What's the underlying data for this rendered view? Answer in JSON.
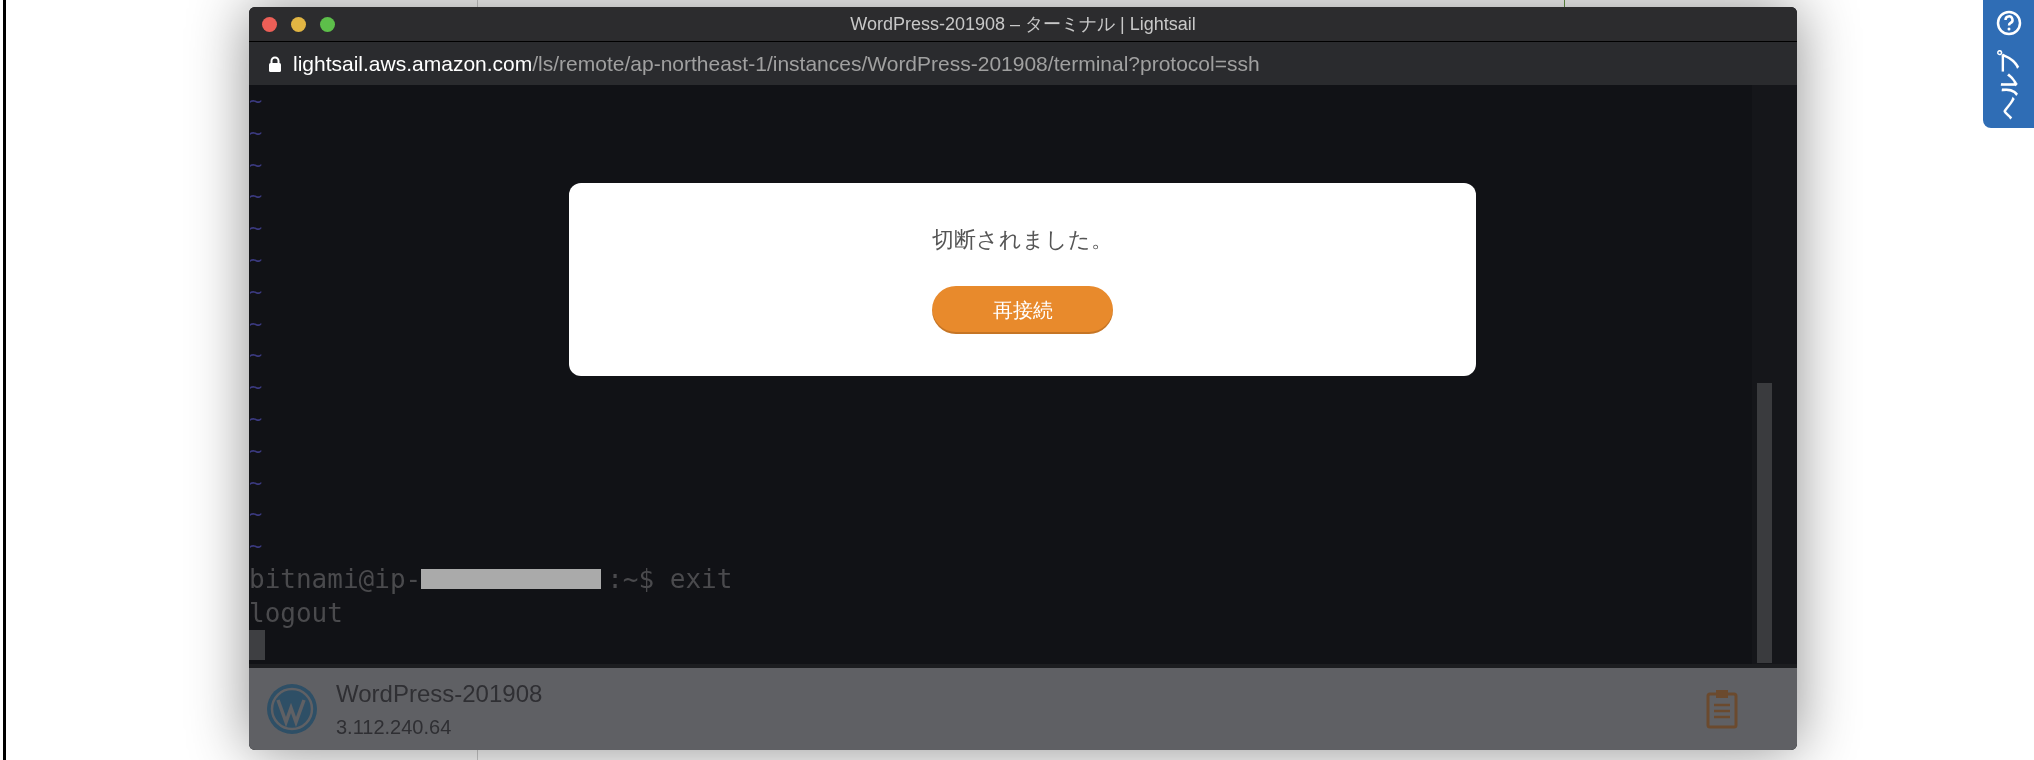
{
  "window": {
    "title": "WordPress-201908 – ターミナル | Lightsail"
  },
  "address_bar": {
    "host": "lightsail.aws.amazon.com",
    "path": "/ls/remote/ap-northeast-1/instances/WordPress-201908/terminal?protocol=ssh"
  },
  "terminal": {
    "empty_lines": [
      "~",
      "~",
      "~",
      "~",
      "~",
      "~",
      "~",
      "~",
      "~",
      "~",
      "~",
      "~",
      "~",
      "~",
      "~"
    ],
    "prompt": {
      "before_redaction": "bitnami@ip-",
      "after_redaction": ":~$ exit"
    },
    "output": [
      "logout"
    ]
  },
  "dialog": {
    "message": "切断されました。",
    "button": "再接続"
  },
  "instance_bar": {
    "name": "WordPress-201908",
    "ip": "3.112.240.64"
  },
  "help_tab": {
    "label": "ヘルプ"
  }
}
